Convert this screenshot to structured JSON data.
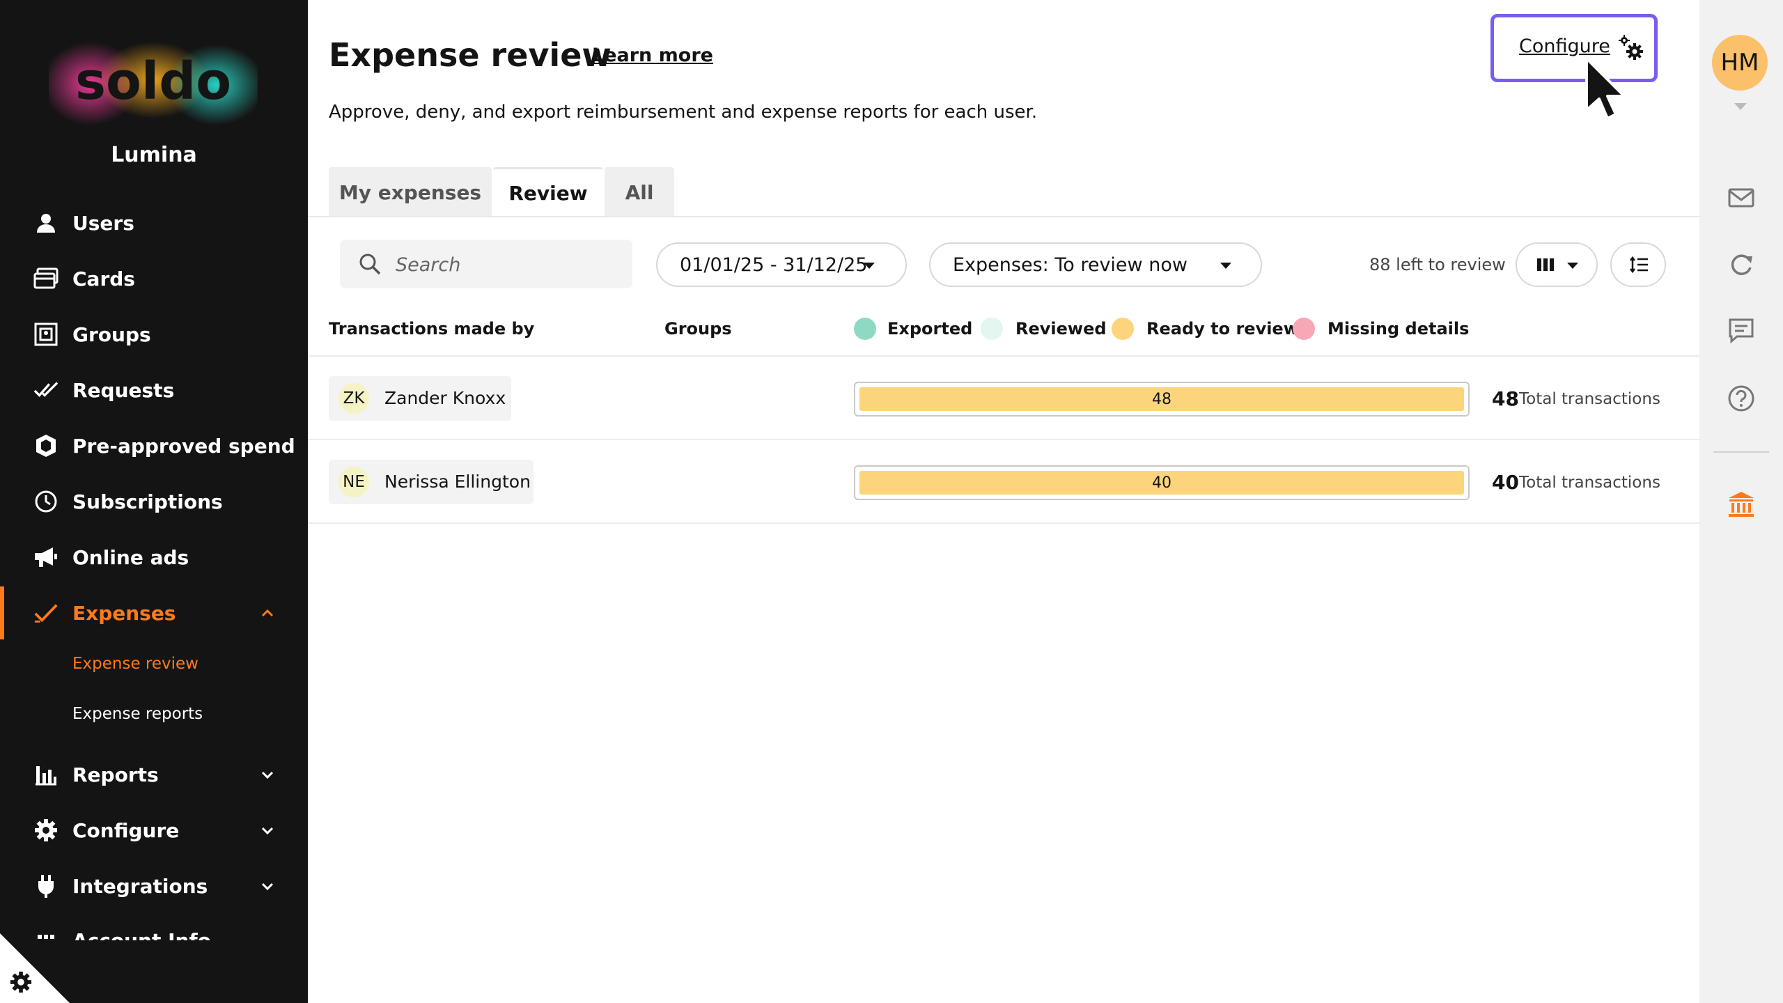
{
  "org": {
    "logo": "soldo",
    "name": "Lumina"
  },
  "nav": {
    "items": [
      {
        "key": "users",
        "label": "Users",
        "icon": "user-icon"
      },
      {
        "key": "cards",
        "label": "Cards",
        "icon": "card-icon"
      },
      {
        "key": "groups",
        "label": "Groups",
        "icon": "groups-icon"
      },
      {
        "key": "requests",
        "label": "Requests",
        "icon": "double-check-icon"
      },
      {
        "key": "pre-approved-spend",
        "label": "Pre-approved spend",
        "icon": "shield-icon"
      },
      {
        "key": "subscriptions",
        "label": "Subscriptions",
        "icon": "clock-icon"
      },
      {
        "key": "online-ads",
        "label": "Online ads",
        "icon": "megaphone-icon"
      },
      {
        "key": "expenses",
        "label": "Expenses",
        "icon": "check-icon",
        "active": true,
        "expanded": true
      },
      {
        "key": "reports",
        "label": "Reports",
        "icon": "bar-chart-icon"
      },
      {
        "key": "configure",
        "label": "Configure",
        "icon": "gear-icon"
      },
      {
        "key": "integrations",
        "label": "Integrations",
        "icon": "plug-icon"
      },
      {
        "key": "account-info",
        "label": "Account Info",
        "icon": "grid-icon"
      }
    ],
    "expenses_sub": [
      {
        "label": "Expense review",
        "active": true
      },
      {
        "label": "Expense reports"
      }
    ]
  },
  "header": {
    "title": "Expense review",
    "learn_more": "Learn more",
    "subtitle": "Approve, deny, and export reimbursement and expense reports for each user.",
    "configure_label": "Configure"
  },
  "tabs": [
    {
      "label": "My expenses"
    },
    {
      "label": "Review",
      "active": true
    },
    {
      "label": "All"
    }
  ],
  "toolbar": {
    "search_placeholder": "Search",
    "date_range": "01/01/25 - 31/12/25",
    "filter": "Expenses: To review now",
    "left_to_review": "88 left to review"
  },
  "table": {
    "col_transactions": "Transactions made by",
    "col_groups": "Groups",
    "legend": [
      {
        "label": "Exported",
        "color": "#8fd8c4"
      },
      {
        "label": "Reviewed",
        "color": "#e3f6ef"
      },
      {
        "label": "Ready to review",
        "color": "#fcd47c"
      },
      {
        "label": "Missing details",
        "color": "#f7a7b5"
      }
    ],
    "rows": [
      {
        "initials": "ZK",
        "name": "Zander Knoxx",
        "ready": 48,
        "total": "48",
        "total_label": "Total transactions"
      },
      {
        "initials": "NE",
        "name": "Nerissa Ellington",
        "ready": 40,
        "total": "40",
        "total_label": "Total transactions"
      }
    ]
  },
  "rail": {
    "avatar_initials": "HM",
    "icons": [
      "mail-icon",
      "refresh-icon",
      "chat-icon",
      "help-icon",
      "bank-icon"
    ]
  },
  "colors": {
    "accent": "#ff7a1a",
    "configure_border": "#7b5cf0"
  }
}
